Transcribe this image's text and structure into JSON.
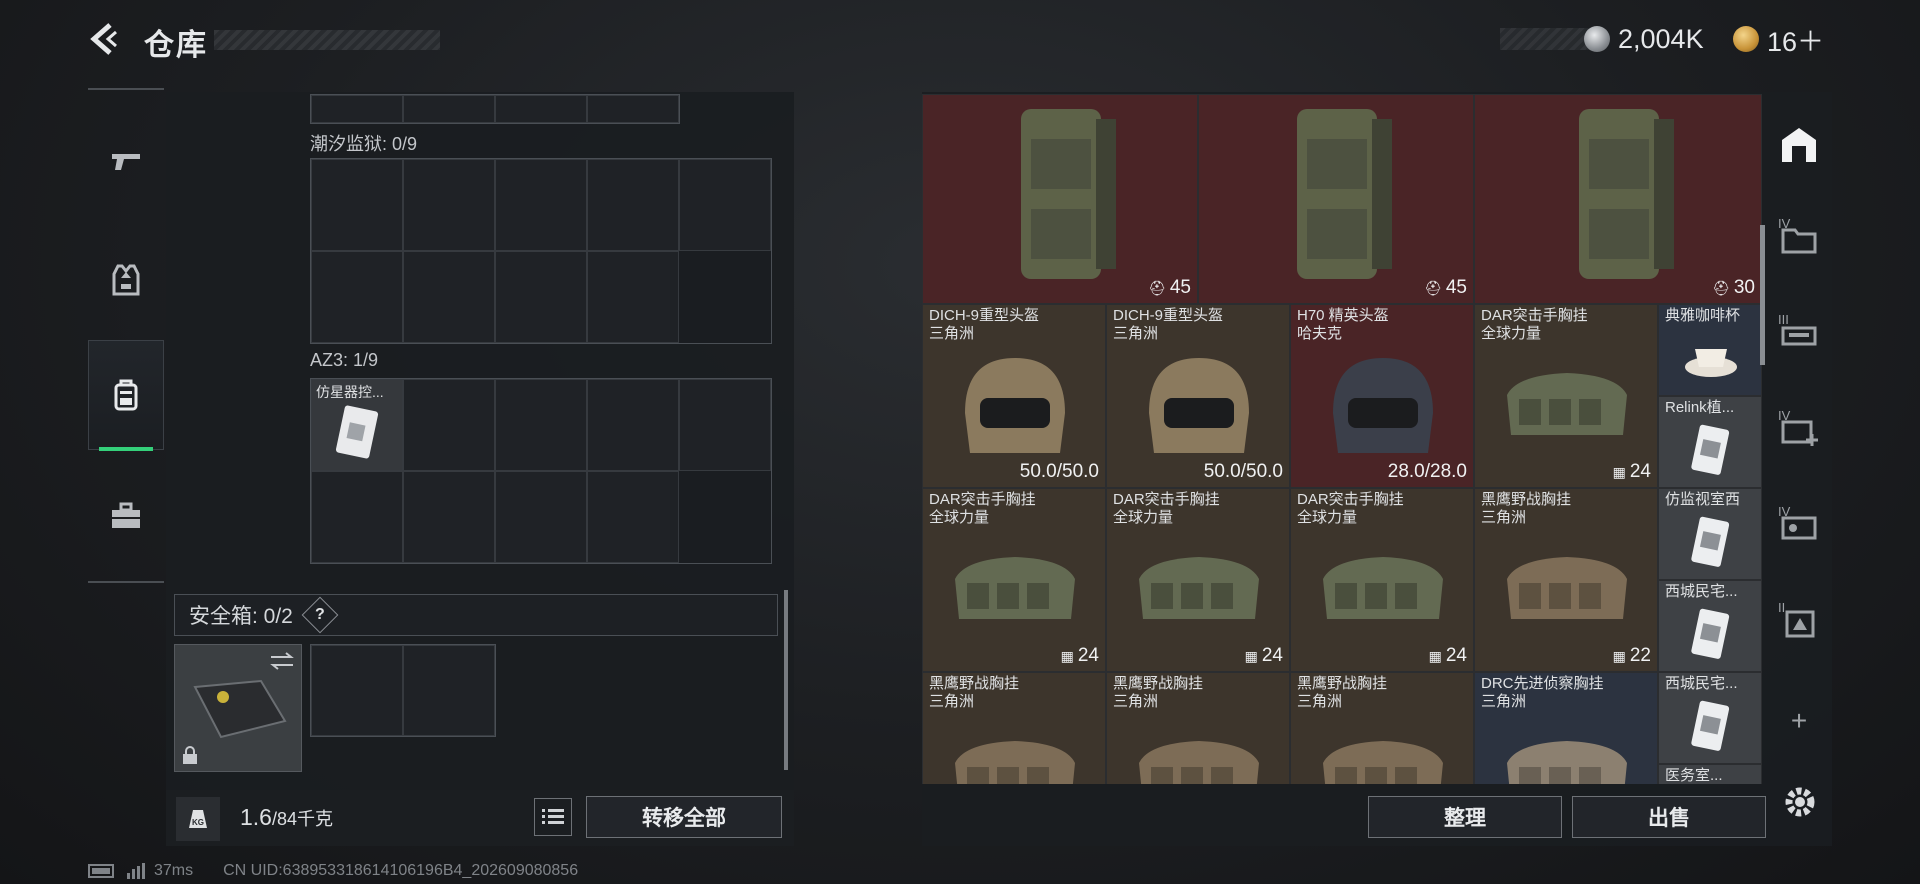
{
  "header": {
    "title": "仓库",
    "silver_amount": "2,004K",
    "gold_amount": "16＋"
  },
  "left": {
    "section1_label": "潮汐监狱: 0/9",
    "section2_label": "AZ3: 1/9",
    "az3_item_name": "仿星器控...",
    "safe_label": "安全箱: 0/2",
    "help_glyph": "?",
    "weight_value": "1.6",
    "weight_unit": "/84千克",
    "transfer_all": "转移全部"
  },
  "right": {
    "items": [
      {
        "name": "",
        "sub": "",
        "value": "45",
        "bg": "red"
      },
      {
        "name": "",
        "sub": "",
        "value": "45",
        "bg": "red"
      },
      {
        "name": "",
        "sub": "",
        "value": "30",
        "bg": "red"
      },
      {
        "name": "DICH-9重型头盔",
        "sub": "三角洲",
        "value": "50.0/50.0",
        "bg": "brown"
      },
      {
        "name": "DICH-9重型头盔",
        "sub": "三角洲",
        "value": "50.0/50.0",
        "bg": "brown"
      },
      {
        "name": "H70 精英头盔",
        "sub": "哈夫克",
        "value": "28.0/28.0",
        "bg": "red"
      },
      {
        "name": "DAR突击手胸挂",
        "sub": "全球力量",
        "value": "24",
        "bg": "brown"
      },
      {
        "name": "典雅咖啡杯",
        "sub": "",
        "value": "",
        "bg": "blue"
      },
      {
        "name": "Relink植...",
        "sub": "",
        "value": "",
        "bg": "gray"
      },
      {
        "name": "DAR突击手胸挂",
        "sub": "全球力量",
        "value": "24",
        "bg": "brown"
      },
      {
        "name": "DAR突击手胸挂",
        "sub": "全球力量",
        "value": "24",
        "bg": "brown"
      },
      {
        "name": "DAR突击手胸挂",
        "sub": "全球力量",
        "value": "24",
        "bg": "brown"
      },
      {
        "name": "黑鹰野战胸挂",
        "sub": "三角洲",
        "value": "22",
        "bg": "brown"
      },
      {
        "name": "仿监视室西",
        "sub": "",
        "value": "",
        "bg": "gray"
      },
      {
        "name": "西城民宅...",
        "sub": "",
        "value": "",
        "bg": "gray"
      },
      {
        "name": "黑鹰野战胸挂",
        "sub": "三角洲",
        "value": "",
        "bg": "brown"
      },
      {
        "name": "黑鹰野战胸挂",
        "sub": "三角洲",
        "value": "",
        "bg": "brown"
      },
      {
        "name": "黑鹰野战胸挂",
        "sub": "三角洲",
        "value": "",
        "bg": "brown"
      },
      {
        "name": "DRC先进侦察胸挂",
        "sub": "三角洲",
        "value": "",
        "bg": "blue"
      },
      {
        "name": "西城民宅...",
        "sub": "",
        "value": "",
        "bg": "gray"
      },
      {
        "name": "医务室...",
        "sub": "",
        "value": "",
        "bg": "gray"
      }
    ],
    "sort_label": "整理",
    "sell_label": "出售",
    "rail_roman": [
      "IV",
      "III",
      "IV",
      "IV",
      "II"
    ],
    "rail_add": "+"
  },
  "status": {
    "ping": "37ms",
    "uid": "CN UID:638953318614106196B4_202609080856"
  },
  "colors": {
    "accent": "#34d07a",
    "red_cell": "#4a2426",
    "brown_cell": "#3d352c"
  }
}
